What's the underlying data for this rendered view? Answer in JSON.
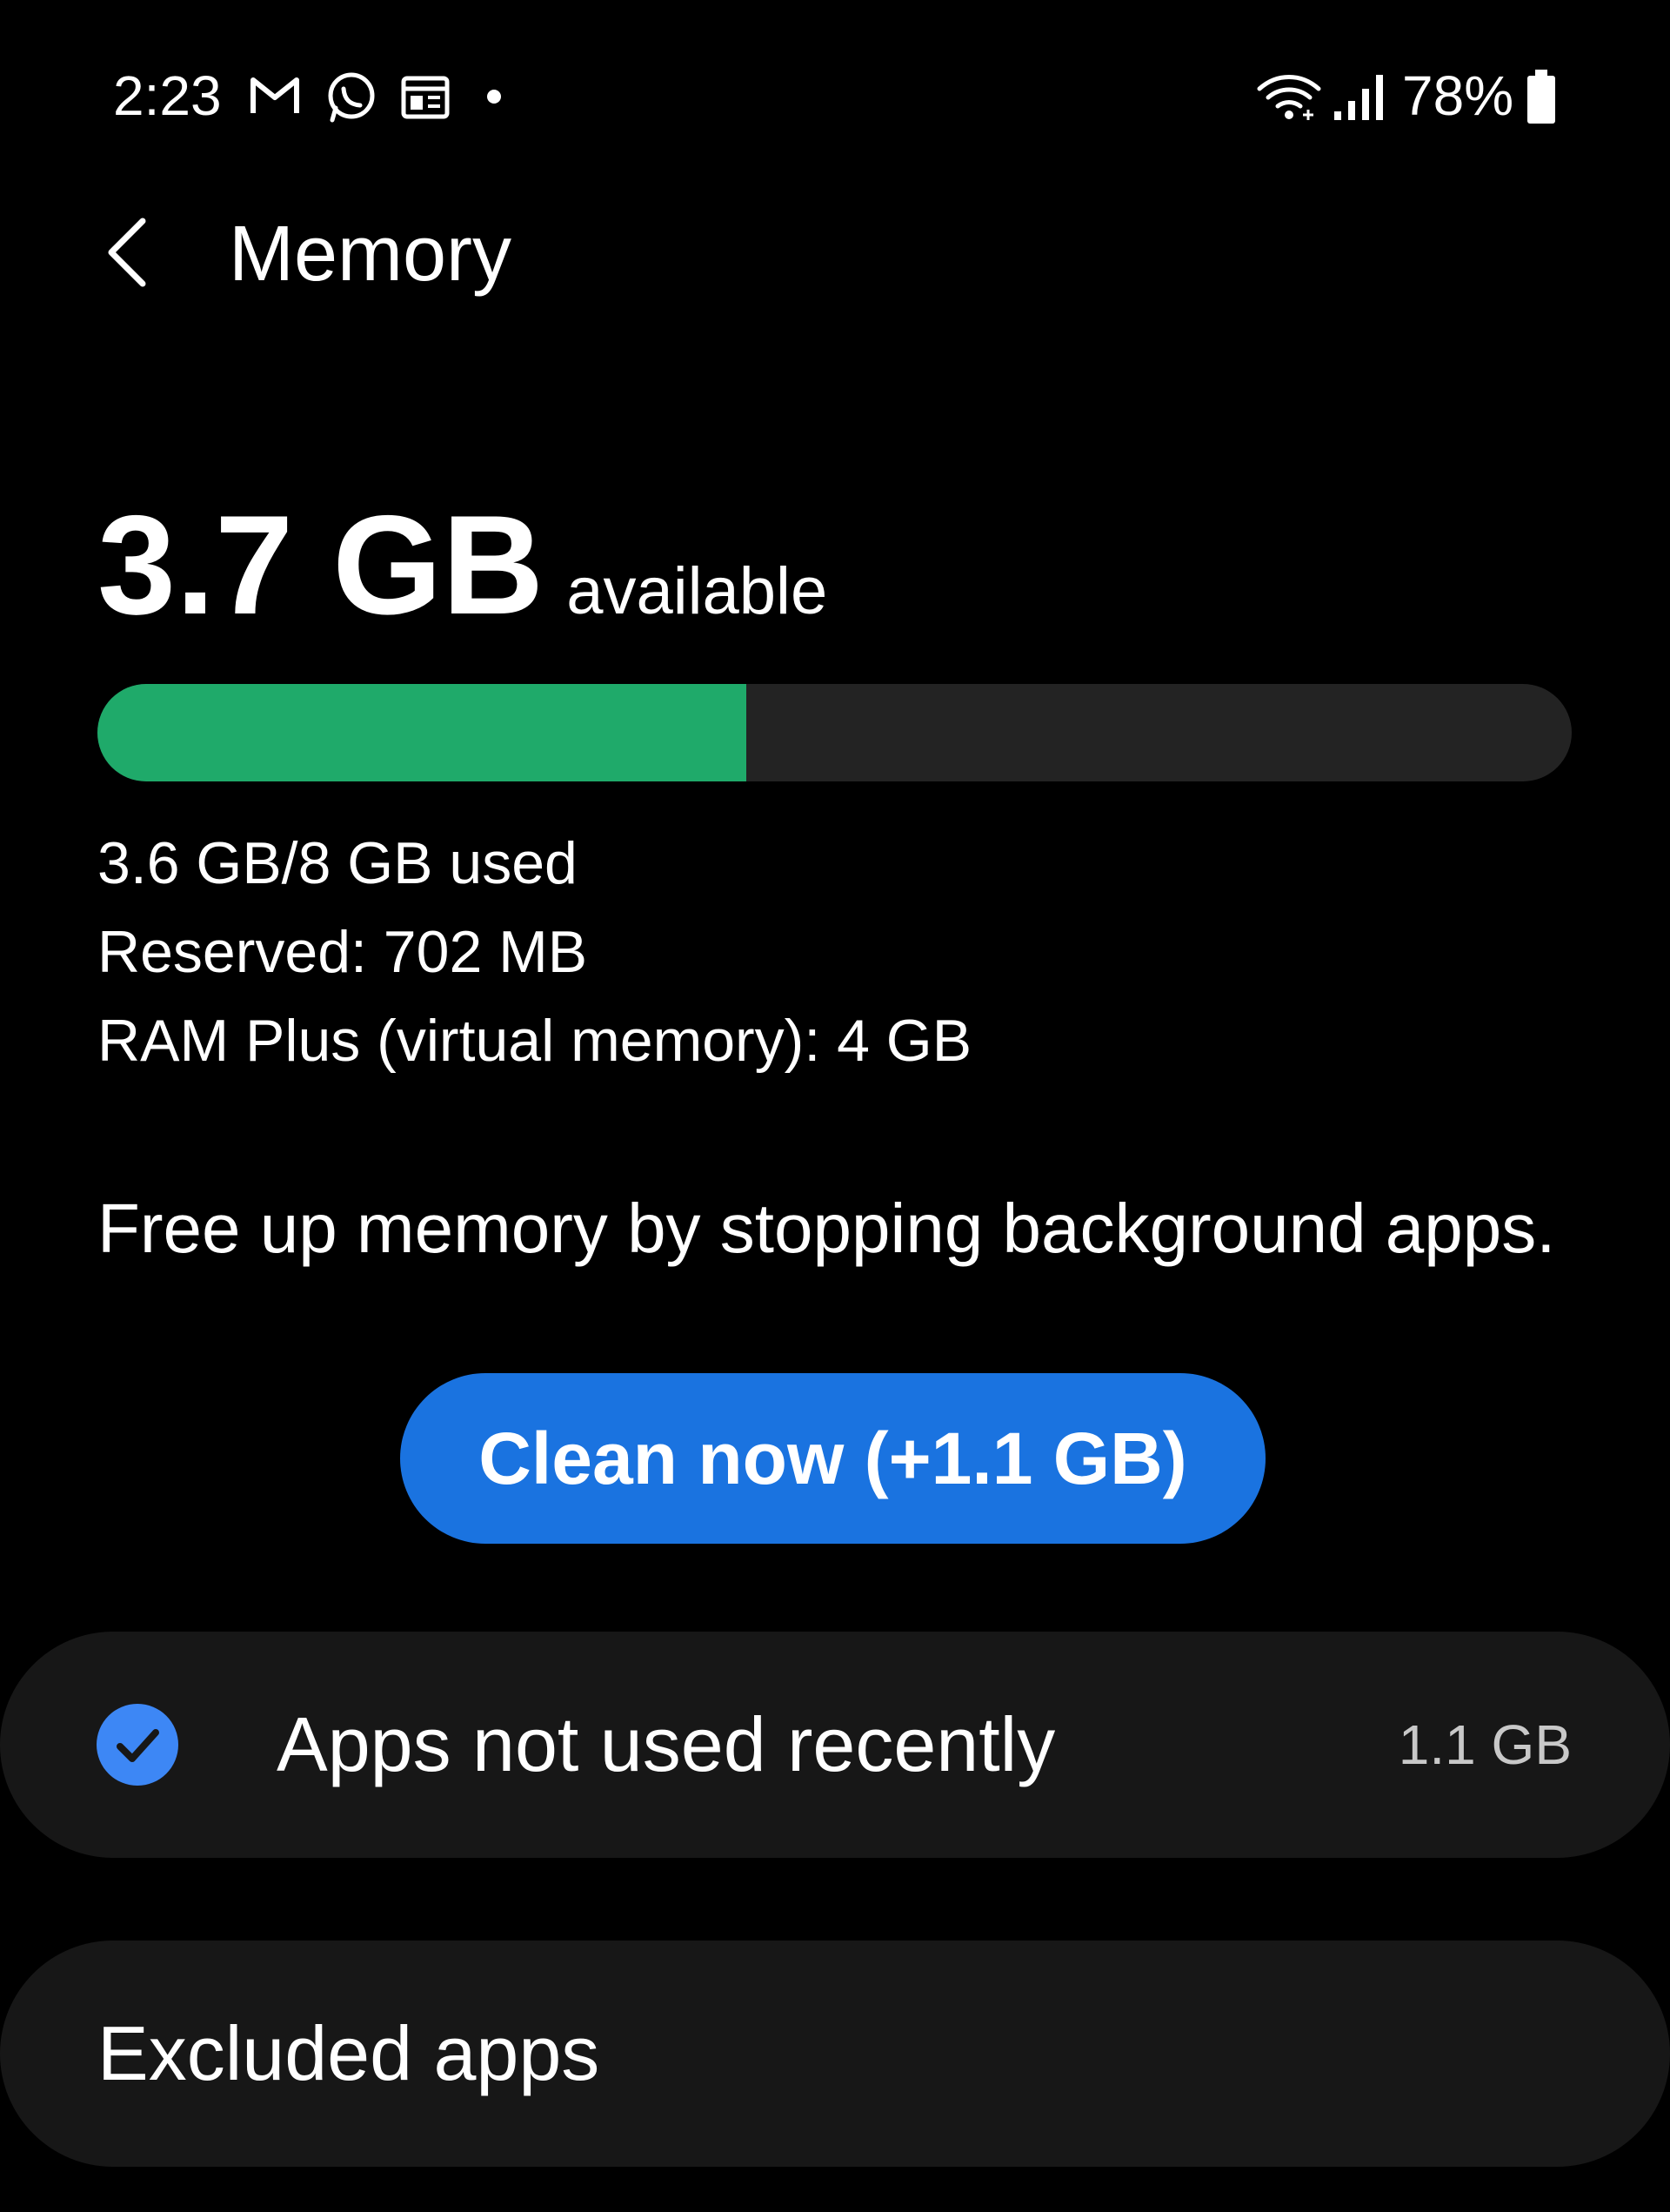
{
  "status_bar": {
    "time": "2:23",
    "battery_percent": "78%",
    "notification_icons": [
      "gmail-icon",
      "whatsapp-icon",
      "calendar-icon",
      "dot-icon"
    ],
    "system_icons": [
      "wifi-icon",
      "signal-icon",
      "battery-icon"
    ]
  },
  "header": {
    "back_icon": "chevron-left-icon",
    "title": "Memory"
  },
  "memory": {
    "available_value": "3.7 GB",
    "available_label": "available",
    "used_fraction": 0.44,
    "used_text": "3.6 GB/8 GB used",
    "reserved_text": "Reserved: 702 MB",
    "ram_plus_text": "RAM Plus (virtual memory): 4 GB",
    "description": "Free up memory by stopping background apps.",
    "colors": {
      "used_bar": "#1faa6a",
      "track": "#232323",
      "accent_blue": "#1a73e0"
    }
  },
  "clean_button": {
    "label": "Clean now (+1.1 GB)"
  },
  "apps_not_used": {
    "checked": true,
    "label": "Apps not used recently",
    "size": "1.1 GB"
  },
  "excluded_apps": {
    "label": "Excluded apps"
  }
}
